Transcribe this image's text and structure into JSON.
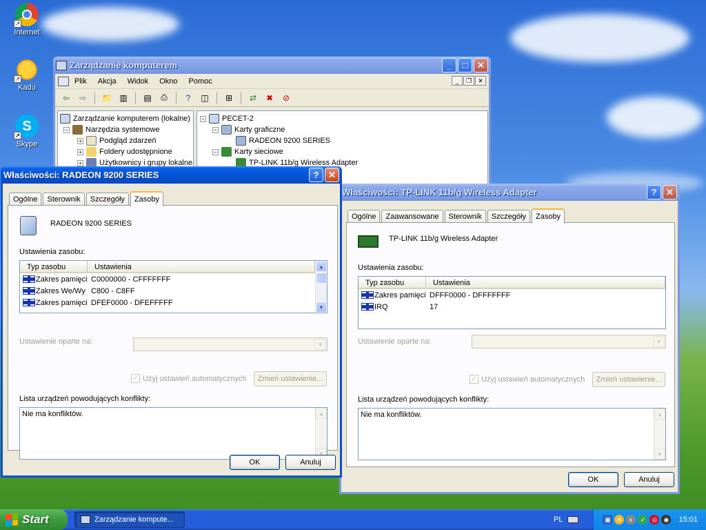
{
  "desktop": {
    "icons": [
      {
        "label": "Internet",
        "icon": "chrome-icon"
      },
      {
        "label": "Kadu",
        "icon": "kadu-sun-icon"
      },
      {
        "label": "Skype",
        "icon": "skype-icon"
      }
    ]
  },
  "mmc": {
    "title": "Zarządzanie komputerem",
    "menu": [
      "Plik",
      "Akcja",
      "Widok",
      "Okno",
      "Pomoc"
    ],
    "left_tree": [
      {
        "label": "Zarządzanie komputerem (lokalne)",
        "indent": 0,
        "expander": ""
      },
      {
        "label": "Narzędzia systemowe",
        "indent": 1,
        "expander": "−"
      },
      {
        "label": "Podgląd zdarzeń",
        "indent": 2,
        "expander": "+"
      },
      {
        "label": "Foldery udostępnione",
        "indent": 2,
        "expander": "+"
      },
      {
        "label": "Użytkownicy i grupy lokalne",
        "indent": 2,
        "expander": "+"
      }
    ],
    "right_tree": [
      {
        "label": "PECET-2",
        "indent": 0,
        "expander": "−"
      },
      {
        "label": "Karty graficzne",
        "indent": 1,
        "expander": "−"
      },
      {
        "label": "RADEON 9200 SERIES",
        "indent": 2,
        "expander": ""
      },
      {
        "label": "Karty sieciowe",
        "indent": 1,
        "expander": "−"
      },
      {
        "label": "TP-LINK 11b/g Wireless Adapter",
        "indent": 2,
        "expander": ""
      }
    ]
  },
  "radeon": {
    "title": "Właściwości: RADEON 9200 SERIES",
    "tabs": [
      "Ogólne",
      "Sterownik",
      "Szczegóły",
      "Zasoby"
    ],
    "device_name": "RADEON 9200 SERIES",
    "resource_settings_label": "Ustawienia zasobu:",
    "col_type": "Typ zasobu",
    "col_settings": "Ustawienia",
    "rows": [
      {
        "type": "Zakres pamięci",
        "value": "C0000000 - CFFFFFFF"
      },
      {
        "type": "Zakres We/Wy",
        "value": "C800 - C8FF"
      },
      {
        "type": "Zakres pamięci",
        "value": "DFEF0000 - DFEFFFFF"
      }
    ],
    "based_on_label": "Ustawienie oparte na:",
    "auto_label": "Użyj ustawień automatycznych",
    "change_label": "Zmień ustawienie...",
    "conflicts_label": "Lista urządzeń powodujących konflikty:",
    "conflicts_text": "Nie ma konfliktów.",
    "ok": "OK",
    "cancel": "Anuluj"
  },
  "tplink": {
    "title": "Właściwości: TP-LINK 11b/g Wireless Adapter",
    "tabs": [
      "Ogólne",
      "Zaawansowane",
      "Sterownik",
      "Szczegóły",
      "Zasoby"
    ],
    "device_name": "TP-LINK 11b/g Wireless Adapter",
    "resource_settings_label": "Ustawienia zasobu:",
    "col_type": "Typ zasobu",
    "col_settings": "Ustawienia",
    "rows": [
      {
        "type": "Zakres pamięci",
        "value": "DFFF0000 - DFFFFFFF"
      },
      {
        "type": "IRQ",
        "value": "17"
      }
    ],
    "based_on_label": "Ustawienie oparte na:",
    "auto_label": "Użyj ustawień automatycznych",
    "change_label": "Zmień ustawienie...",
    "conflicts_label": "Lista urządzeń powodujących konflikty:",
    "conflicts_text": "Nie ma konfliktów.",
    "ok": "OK",
    "cancel": "Anuluj"
  },
  "taskbar": {
    "start_label": "Start",
    "task_label": "Zarządzanie kompute...",
    "language": "PL",
    "clock": "15:01"
  }
}
